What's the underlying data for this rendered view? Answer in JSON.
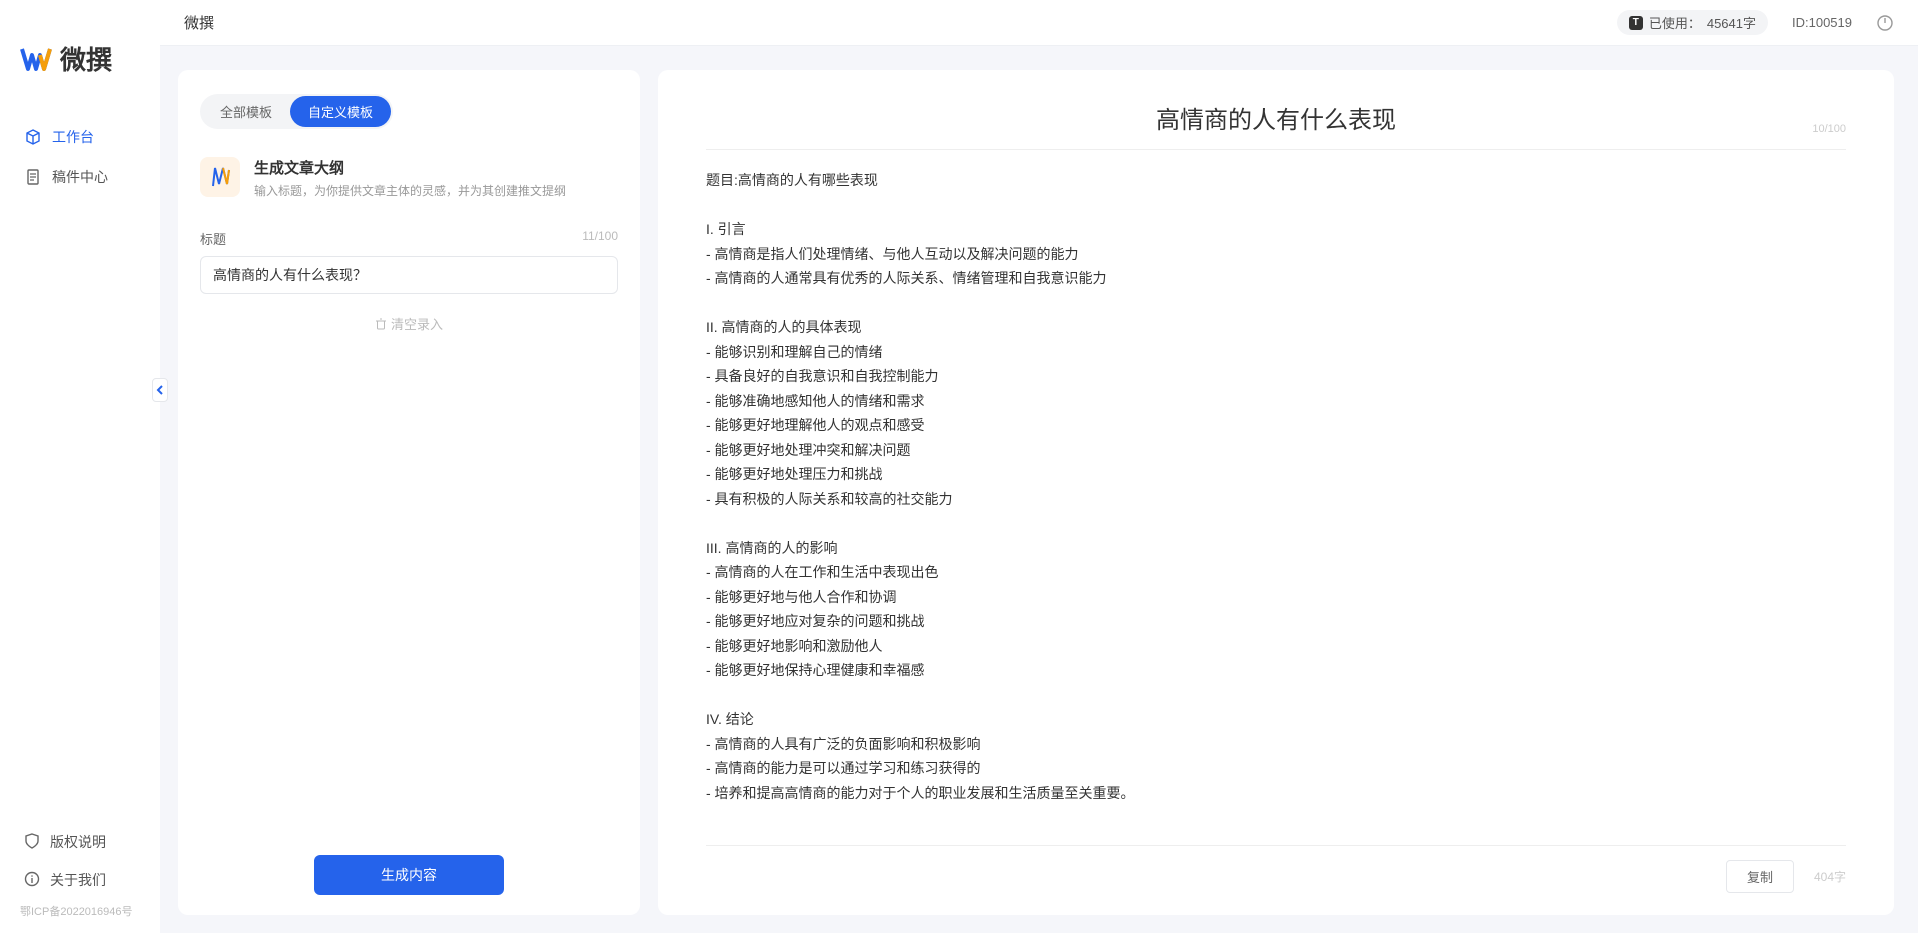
{
  "brand": "微撰",
  "sidebar": {
    "nav": [
      {
        "label": "工作台",
        "icon": "cube"
      },
      {
        "label": "稿件中心",
        "icon": "doc"
      }
    ],
    "bottom": [
      {
        "label": "版权说明",
        "icon": "shield"
      },
      {
        "label": "关于我们",
        "icon": "info"
      }
    ],
    "icp": "鄂ICP备2022016946号"
  },
  "topbar": {
    "title": "微撰",
    "usageLabel": "已使用：",
    "usageValue": "45641字",
    "userId": "ID:100519"
  },
  "left": {
    "tabs": [
      "全部模板",
      "自定义模板"
    ],
    "activeTab": 1,
    "template": {
      "title": "生成文章大纲",
      "desc": "输入标题，为你提供文章主体的灵感，并为其创建推文提纲"
    },
    "fieldLabel": "标题",
    "charCount": "11/100",
    "inputValue": "高情商的人有什么表现？",
    "clearLabel": "清空录入",
    "generateLabel": "生成内容"
  },
  "right": {
    "title": "高情商的人有什么表现",
    "titleCount": "10/100",
    "body": "题目:高情商的人有哪些表现\n\nI. 引言\n- 高情商是指人们处理情绪、与他人互动以及解决问题的能力\n- 高情商的人通常具有优秀的人际关系、情绪管理和自我意识能力\n\nII. 高情商的人的具体表现\n- 能够识别和理解自己的情绪\n- 具备良好的自我意识和自我控制能力\n- 能够准确地感知他人的情绪和需求\n- 能够更好地理解他人的观点和感受\n- 能够更好地处理冲突和解决问题\n- 能够更好地处理压力和挑战\n- 具有积极的人际关系和较高的社交能力\n\nIII. 高情商的人的影响\n- 高情商的人在工作和生活中表现出色\n- 能够更好地与他人合作和协调\n- 能够更好地应对复杂的问题和挑战\n- 能够更好地影响和激励他人\n- 能够更好地保持心理健康和幸福感\n\nIV. 结论\n- 高情商的人具有广泛的负面影响和积极影响\n- 高情商的能力是可以通过学习和练习获得的\n- 培养和提高高情商的能力对于个人的职业发展和生活质量至关重要。",
    "copyLabel": "复制",
    "wordCount": "404字"
  }
}
